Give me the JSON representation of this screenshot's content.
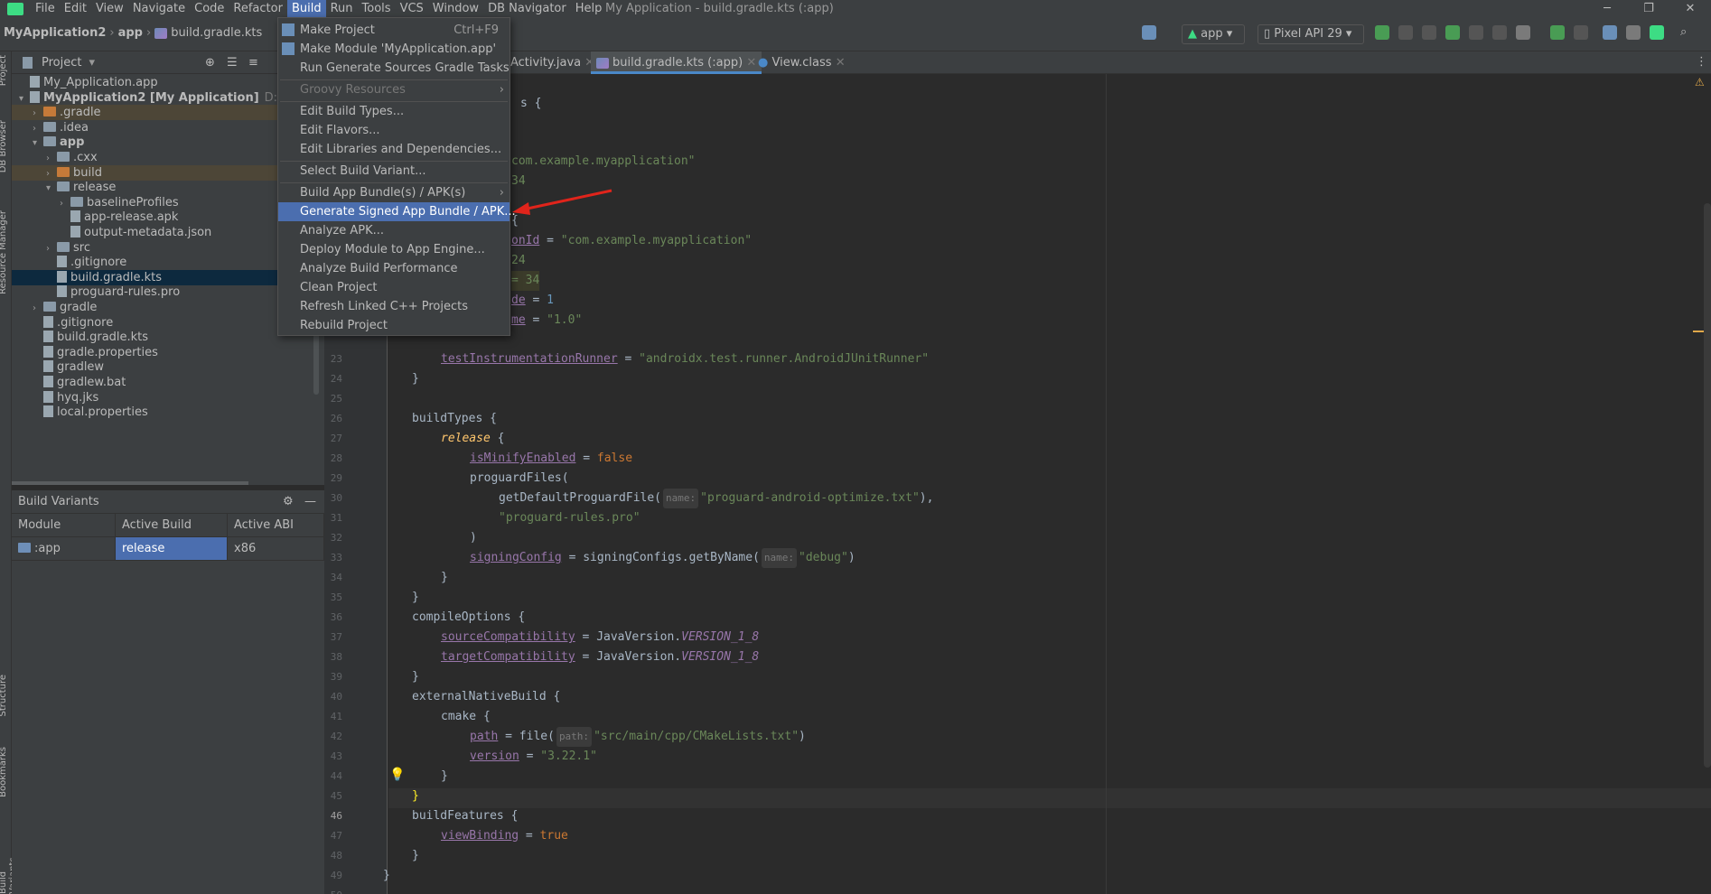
{
  "menubar": {
    "items": [
      "File",
      "Edit",
      "View",
      "Navigate",
      "Code",
      "Refactor",
      "Build",
      "Run",
      "Tools",
      "VCS",
      "Window",
      "DB Navigator",
      "Help"
    ],
    "active_index": 6,
    "window_title": "My Application - build.gradle.kts (:app)"
  },
  "breadcrumb": {
    "project": "MyApplication2",
    "module": "app",
    "file": "build.gradle.kts"
  },
  "toolbar": {
    "run_config": "app",
    "device": "Pixel API 29"
  },
  "left_strip": {
    "tabs": [
      "Project",
      "DB Browser",
      "Resource Manager",
      "Structure",
      "Bookmarks",
      "Build Variants"
    ]
  },
  "project_panel": {
    "title": "Project",
    "tree": [
      {
        "label": "My_Application.app",
        "indent": 0
      },
      {
        "label": "MyApplication2 [My Application]",
        "suffix": "D:\\Andr...",
        "indent": 0
      },
      {
        "label": ".gradle",
        "indent": 1
      },
      {
        "label": ".idea",
        "indent": 1
      },
      {
        "label": "app",
        "indent": 1
      },
      {
        "label": ".cxx",
        "indent": 2
      },
      {
        "label": "build",
        "indent": 2
      },
      {
        "label": "release",
        "indent": 2
      },
      {
        "label": "baselineProfiles",
        "indent": 3
      },
      {
        "label": "app-release.apk",
        "indent": 3
      },
      {
        "label": "output-metadata.json",
        "indent": 3
      },
      {
        "label": "src",
        "indent": 2
      },
      {
        "label": ".gitignore",
        "indent": 2
      },
      {
        "label": "build.gradle.kts",
        "indent": 2
      },
      {
        "label": "proguard-rules.pro",
        "indent": 2
      },
      {
        "label": "gradle",
        "indent": 1
      },
      {
        "label": ".gitignore",
        "indent": 1
      },
      {
        "label": "build.gradle.kts",
        "indent": 1
      },
      {
        "label": "gradle.properties",
        "indent": 1
      },
      {
        "label": "gradlew",
        "indent": 1
      },
      {
        "label": "gradlew.bat",
        "indent": 1
      },
      {
        "label": "hyq.jks",
        "indent": 1
      },
      {
        "label": "local.properties",
        "indent": 1
      }
    ]
  },
  "build_variants": {
    "title": "Build Variants",
    "headers": [
      "Module",
      "Active Build Vari...",
      "Active ABI"
    ],
    "rows": [
      [
        ":app",
        "release",
        "x86"
      ]
    ]
  },
  "editor_tabs": [
    "Activity.java",
    "build.gradle.kts (:app)",
    "View.class"
  ],
  "build_menu": {
    "items": [
      {
        "label": "Make Project",
        "shortcut": "Ctrl+F9"
      },
      {
        "label": "Make Module 'MyApplication.app'"
      },
      {
        "label": "Run Generate Sources Gradle Tasks"
      },
      {
        "label": "Groovy Resources",
        "disabled": true
      },
      {
        "label": "Edit Build Types..."
      },
      {
        "label": "Edit Flavors..."
      },
      {
        "label": "Edit Libraries and Dependencies..."
      },
      {
        "label": "Select Build Variant..."
      },
      {
        "label": "Build App Bundle(s) / APK(s)"
      },
      {
        "label": "Generate Signed App Bundle / APK..."
      },
      {
        "label": "Analyze APK..."
      },
      {
        "label": "Deploy Module to App Engine..."
      },
      {
        "label": "Analyze Build Performance"
      },
      {
        "label": "Clean Project"
      },
      {
        "label": "Refresh Linked C++ Projects"
      },
      {
        "label": "Rebuild Project"
      }
    ]
  },
  "code_fragments": {
    "l4": "s {",
    "l7": "com.example.myapplication\"",
    "l8": "34",
    "l10": "{",
    "l11a": "onId",
    "l11b": " = ",
    "l11c": "\"com.example.myapplication\"",
    "l12": "24",
    "l13": "= 34",
    "l14a": "de",
    "l14b": " = ",
    "l14c": "1",
    "l15a": "me",
    "l15b": " = ",
    "l15c": "\"1.0\""
  },
  "line_numbers": [
    "23",
    "24",
    "25",
    "26",
    "27",
    "28",
    "29",
    "30",
    "31",
    "32",
    "33",
    "34",
    "35",
    "36",
    "37",
    "38",
    "39",
    "40",
    "41",
    "42",
    "43",
    "44",
    "45",
    "46",
    "47",
    "48",
    "49",
    "50"
  ],
  "code": {
    "l24a": "testInstrumentationRunner",
    "l24b": " = ",
    "l24c": "\"androidx.test.runner.AndroidJUnitRunner\"",
    "l25": "}",
    "l27": "buildTypes {",
    "l28a": "release",
    "l28b": " {",
    "l29a": "isMinifyEnabled",
    "l29b": " = ",
    "l29c": "false",
    "l30": "proguardFiles(",
    "l31a": "getDefaultProguardFile(",
    "l31h": "name:",
    "l31c": "\"proguard-android-optimize.txt\"",
    "l31d": "),",
    "l32": "\"proguard-rules.pro\"",
    "l33": ")",
    "l34a": "signingConfig",
    "l34b": " = signingConfigs.getByName(",
    "l34h": "name:",
    "l34c": "\"debug\"",
    "l34d": ")",
    "l35": "}",
    "l36": "}",
    "l37": "compileOptions {",
    "l38a": "sourceCompatibility",
    "l38b": " = JavaVersion.",
    "l38c": "VERSION_1_8",
    "l39a": "targetCompatibility",
    "l39b": " = JavaVersion.",
    "l39c": "VERSION_1_8",
    "l40": "}",
    "l41": "externalNativeBuild {",
    "l42": "cmake {",
    "l43a": "path",
    "l43b": " = file(",
    "l43h": "path:",
    "l43c": "\"src/main/cpp/CMakeLists.txt\"",
    "l43d": ")",
    "l44a": "version",
    "l44b": " = ",
    "l44c": "\"3.22.1\"",
    "l45": "}",
    "l46": "}",
    "l47": "buildFeatures {",
    "l48a": "viewBinding",
    "l48b": " = ",
    "l48c": "true",
    "l49": "}",
    "l50": "}"
  }
}
